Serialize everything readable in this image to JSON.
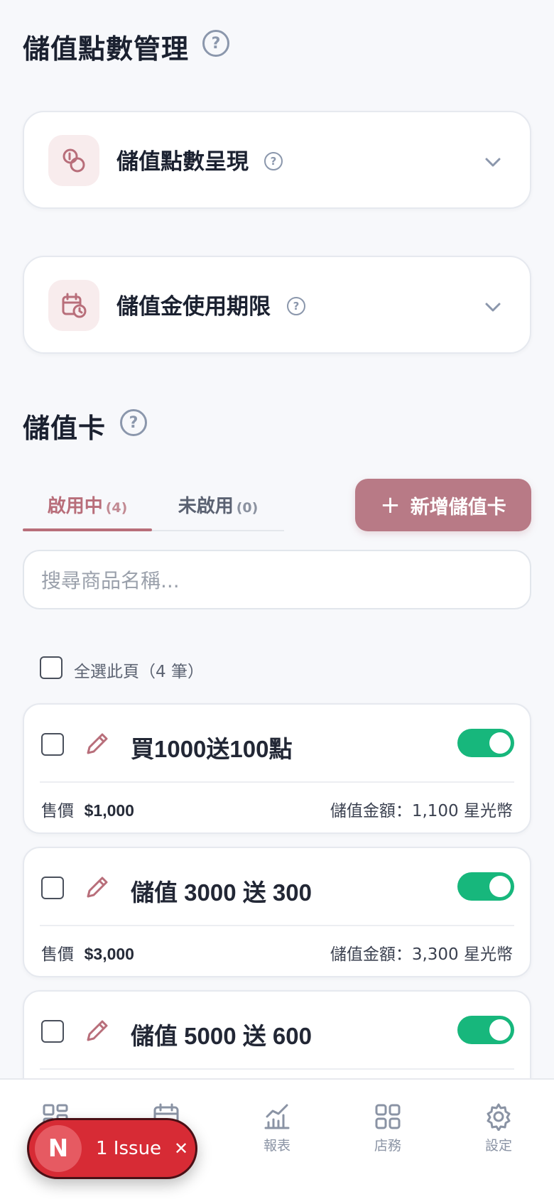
{
  "header": {
    "title": "儲值點數管理",
    "help": "?"
  },
  "sections": [
    {
      "title": "儲值點數呈現",
      "help": "?",
      "icon": "coins-icon"
    },
    {
      "title": "儲值金使用期限",
      "help": "?",
      "icon": "calendar-clock-icon"
    }
  ],
  "cards_section": {
    "title": "儲值卡",
    "help": "?"
  },
  "tabs": [
    {
      "label": "啟用中",
      "count": "(4)",
      "active": true
    },
    {
      "label": "未啟用",
      "count": "(0)",
      "active": false
    }
  ],
  "add_button": {
    "icon": "+",
    "label": "新增儲值卡"
  },
  "search": {
    "placeholder": "搜尋商品名稱..."
  },
  "select_all": {
    "label": "全選此頁（4 筆）"
  },
  "items": [
    {
      "title": "買1000送100點",
      "price_label": "售價",
      "price": "$1,000",
      "amount": "儲值金額：1,100 星光幣",
      "enabled": true
    },
    {
      "title": "儲值 3000 送 300",
      "price_label": "售價",
      "price": "$3,000",
      "amount": "儲值金額：3,300 星光幣",
      "enabled": true
    },
    {
      "title": "儲值 5000 送 600",
      "enabled": true
    }
  ],
  "bottom_nav": [
    {
      "label": "",
      "icon": "dashboard-icon"
    },
    {
      "label": "",
      "icon": "calendar-icon"
    },
    {
      "label": "報表",
      "icon": "chart-icon"
    },
    {
      "label": "店務",
      "icon": "grid-icon"
    },
    {
      "label": "設定",
      "icon": "gear-icon"
    }
  ],
  "issue_badge": {
    "letter": "N",
    "label": "1 Issue",
    "close": "✕"
  },
  "colors": {
    "accent": "#b87a86",
    "toggle_on": "#17b77c",
    "issue": "#d72b35"
  }
}
